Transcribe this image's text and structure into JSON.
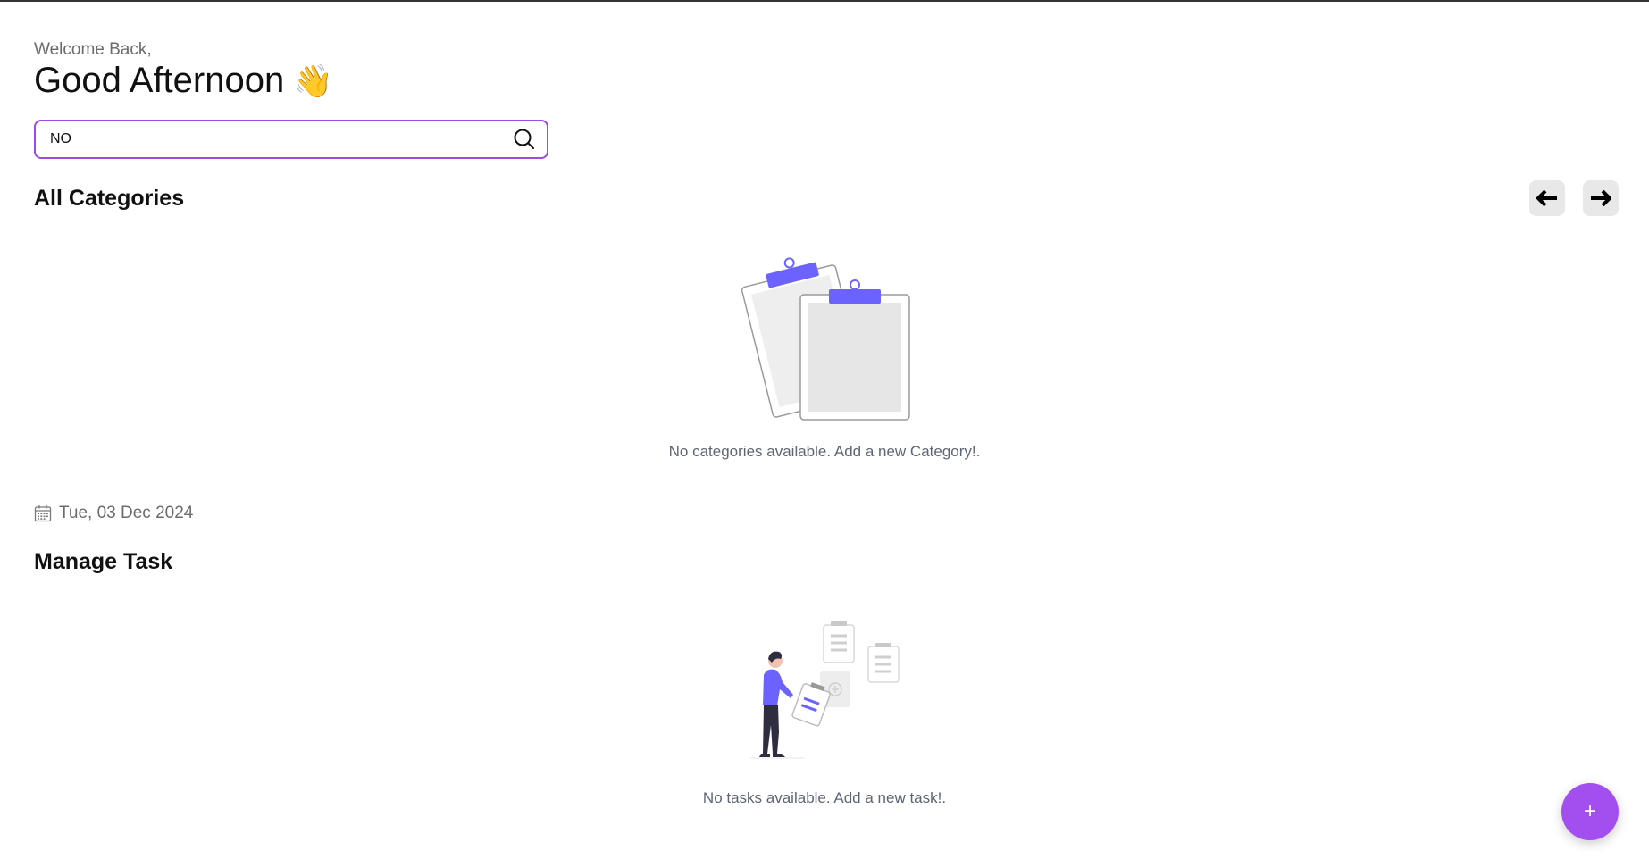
{
  "header": {
    "welcome": "Welcome Back,",
    "greeting": "Good Afternoon",
    "wave_emoji": "👋"
  },
  "search": {
    "value": "NO",
    "icon": "search-icon"
  },
  "categories": {
    "title": "All Categories",
    "prev_icon": "arrow-left-icon",
    "next_icon": "arrow-right-icon",
    "empty_message": "No categories available. Add a new Category!."
  },
  "date": {
    "icon": "calendar-icon",
    "label": "Tue, 03 Dec 2024"
  },
  "tasks": {
    "title": "Manage Task",
    "empty_message": "No tasks available. Add a new task!."
  },
  "fab": {
    "label": "+"
  },
  "colors": {
    "accent": "#a34ff0",
    "illustration": "#6c63ff"
  }
}
